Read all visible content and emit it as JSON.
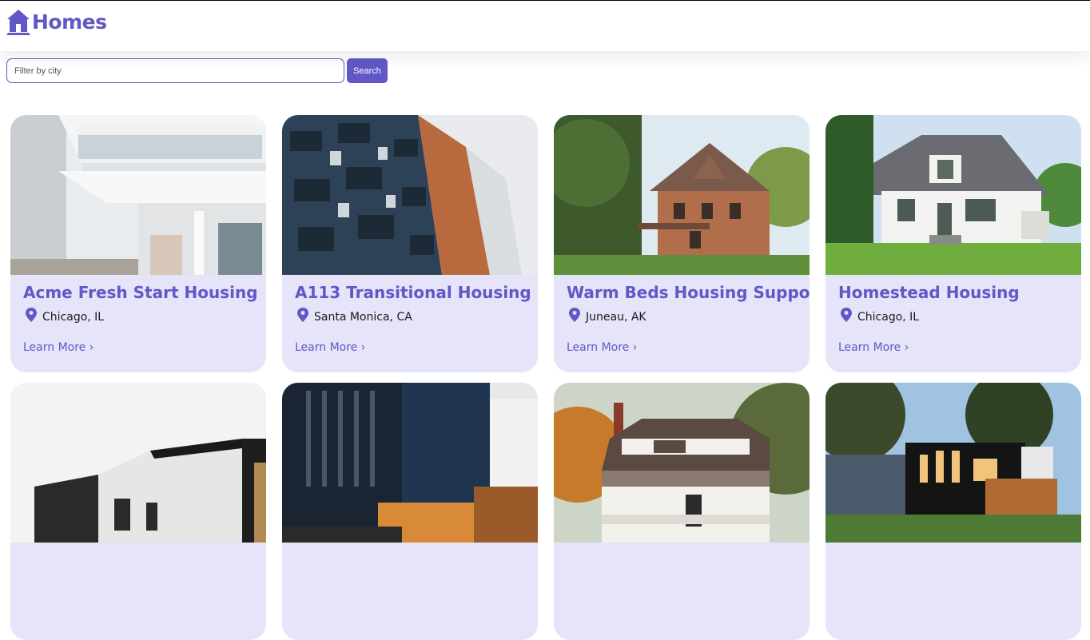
{
  "header": {
    "brand_name": "Homes",
    "logo_icon": "house-icon",
    "accent_color": "#6157c6"
  },
  "search": {
    "placeholder": "Filter by city",
    "value": "",
    "button_label": "Search"
  },
  "listings": [
    {
      "title": "Acme Fresh Start Housing",
      "location": "Chicago, IL",
      "link_label": "Learn More ›",
      "image": "modern-white-apartment-balconies"
    },
    {
      "title": "A113 Transitional Housing",
      "location": "Santa Monica, CA",
      "link_label": "Learn More ›",
      "image": "blue-apartment-building-balconies"
    },
    {
      "title": "Warm Beds Housing Support",
      "location": "Juneau, AK",
      "link_label": "Learn More ›",
      "image": "victorian-brick-house"
    },
    {
      "title": "Homestead Housing",
      "location": "Chicago, IL",
      "link_label": "Learn More ›",
      "image": "white-cottage-house"
    },
    {
      "title": "",
      "location": "",
      "link_label": "",
      "image": "modern-minimal-house"
    },
    {
      "title": "",
      "location": "",
      "link_label": "",
      "image": "dark-modern-building-night"
    },
    {
      "title": "",
      "location": "",
      "link_label": "",
      "image": "house-autumn-trees"
    },
    {
      "title": "",
      "location": "",
      "link_label": "",
      "image": "modern-black-house-dusk"
    }
  ]
}
